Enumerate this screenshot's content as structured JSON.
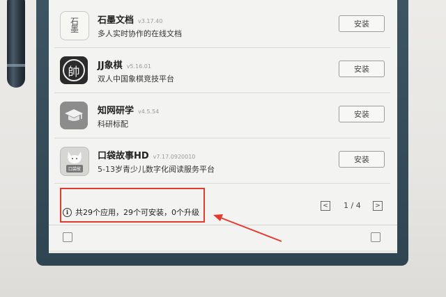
{
  "apps": [
    {
      "name": "石墨文档",
      "version": "v3.17.40",
      "desc": "多人实时协作的在线文档",
      "button": "安装",
      "icon_text_top": "石",
      "icon_text_bottom": "墨"
    },
    {
      "name": "JJ象棋",
      "version": "v5.16.01",
      "desc": "双人中国象棋竞技平台",
      "button": "安装",
      "icon_text": "帥"
    },
    {
      "name": "知网研学",
      "version": "v4.5.54",
      "desc": "科研标配",
      "button": "安装"
    },
    {
      "name": "口袋故事HD",
      "version": "v7.17.0920010",
      "desc": "5-13岁青少儿数字化阅读服务平台",
      "button": "安装",
      "icon_tag": "口袋故"
    }
  ],
  "status": {
    "text": "共29个应用，29个可安装，0个升级",
    "info_glyph": "i"
  },
  "pager": {
    "text": "1 / 4",
    "prev": "<",
    "next": ">"
  },
  "colors": {
    "highlight": "#e53a2e",
    "device_frame": "#3e5563",
    "screen": "#f3f3f1"
  }
}
